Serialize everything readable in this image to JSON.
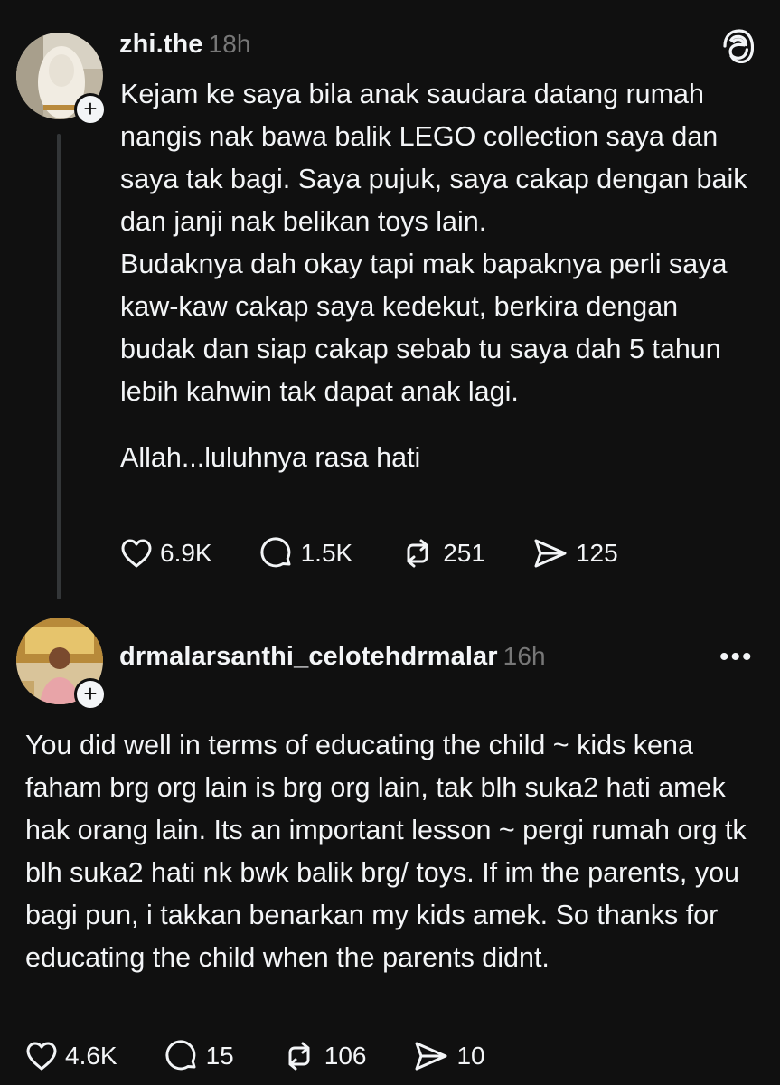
{
  "posts": [
    {
      "username": "zhi.the",
      "time": "18h",
      "paragraphs": [
        "Kejam ke saya bila anak saudara datang rumah nangis nak bawa balik LEGO collection saya dan saya tak bagi. Saya pujuk, saya cakap dengan baik dan janji nak belikan toys lain.",
        "Budaknya dah okay tapi mak bapaknya perli saya kaw-kaw cakap saya kedekut, berkira dengan budak dan siap cakap sebab tu saya dah 5 tahun lebih kahwin tak dapat anak lagi.",
        "Allah...luluhnya rasa hati"
      ],
      "likes": "6.9K",
      "replies": "1.5K",
      "reposts": "251",
      "shares": "125",
      "follow_icon": "+"
    },
    {
      "username": "drmalarsanthi_celotehdrmalar",
      "time": "16h",
      "text": "You did well in terms of educating the child ~ kids kena faham brg org lain is brg org lain, tak blh suka2 hati amek hak orang lain. Its an important lesson ~ pergi rumah org tk blh suka2 hati nk bwk balik brg/ toys. If im the parents, you bagi pun, i takkan benarkan my kids amek. So thanks for educating the child when the parents didnt.",
      "likes": "4.6K",
      "replies": "15",
      "reposts": "106",
      "shares": "10",
      "follow_icon": "+",
      "more_icon": "•••"
    }
  ],
  "icons": {
    "app_logo": "threads-logo-icon",
    "like": "heart-icon",
    "reply": "comment-icon",
    "repost": "repost-icon",
    "share": "send-icon"
  },
  "colors": {
    "background": "#101010",
    "text": "#f3f5f7",
    "muted": "#777777"
  }
}
